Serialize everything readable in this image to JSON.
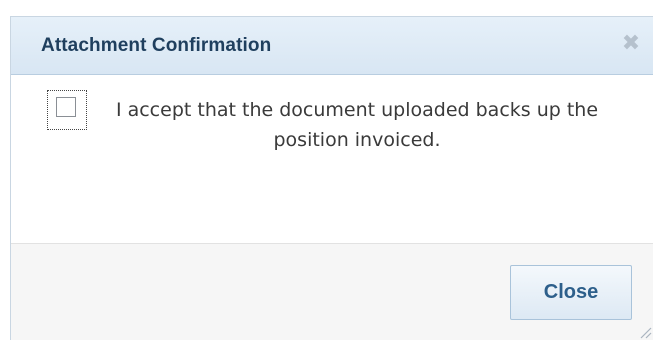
{
  "dialog": {
    "title": "Attachment Confirmation",
    "close_icon": "close-icon",
    "checkbox": {
      "checked": false,
      "label": "I accept that the document uploaded backs up the position invoiced."
    },
    "footer": {
      "close_label": "Close"
    },
    "resize_icon": "resize-grip-icon"
  },
  "colors": {
    "titlebar_bg": "#dde9f4",
    "title_text": "#1f3f5e",
    "button_text": "#2d5f8b",
    "footer_bg": "#f6f6f6"
  }
}
